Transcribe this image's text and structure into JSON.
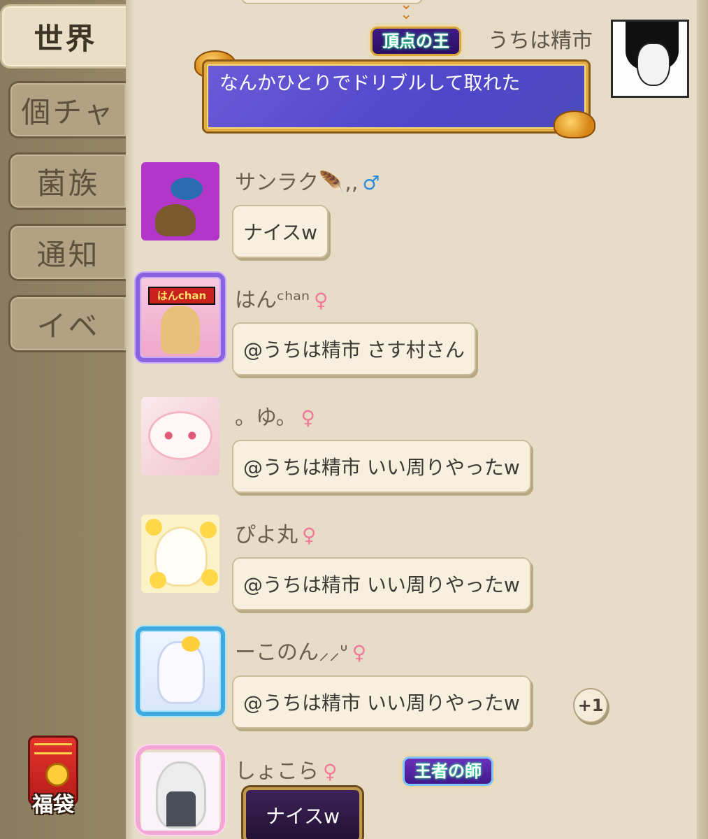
{
  "sidebar": {
    "tabs": [
      {
        "label": "世界",
        "active": true
      },
      {
        "label": "個チャ",
        "active": false
      },
      {
        "label": "菌族",
        "active": false
      },
      {
        "label": "通知",
        "active": false
      },
      {
        "label": "イベ",
        "active": false
      }
    ],
    "fukubukuro_label": "福袋"
  },
  "chat": {
    "own_message": {
      "title_badge": "頂点の王",
      "user_name": "うちは精市",
      "text": "なんかひとりでドリブルして取れた"
    },
    "messages": [
      {
        "user_name": "サンラク🪶,,",
        "gender": "♂",
        "text": "ナイスw"
      },
      {
        "user_name": "はんᶜʰᵃⁿ",
        "gender": "♀",
        "text": "@うちは精市 さす村さん"
      },
      {
        "user_name": "。ゆ。",
        "gender": "♀",
        "text": "@うちは精市 いい周りやったw"
      },
      {
        "user_name": "ぴよ丸",
        "gender": "♀",
        "text": "@うちは精市 いい周りやったw"
      },
      {
        "user_name": "ーこのん⸝⸝ᐡ",
        "gender": "♀",
        "text": "@うちは精市 いい周りやったw",
        "reaction": "+1"
      },
      {
        "user_name": "しょこら",
        "gender": "♀",
        "title_badge": "王者の師",
        "text": "ナイスw"
      }
    ]
  },
  "colors": {
    "panel_bg": "#e6dcc7",
    "sidebar_bg": "#8d7c5f",
    "male": "#2f8de0",
    "female": "#f07a9a",
    "own_bubble": "#5249c8"
  }
}
